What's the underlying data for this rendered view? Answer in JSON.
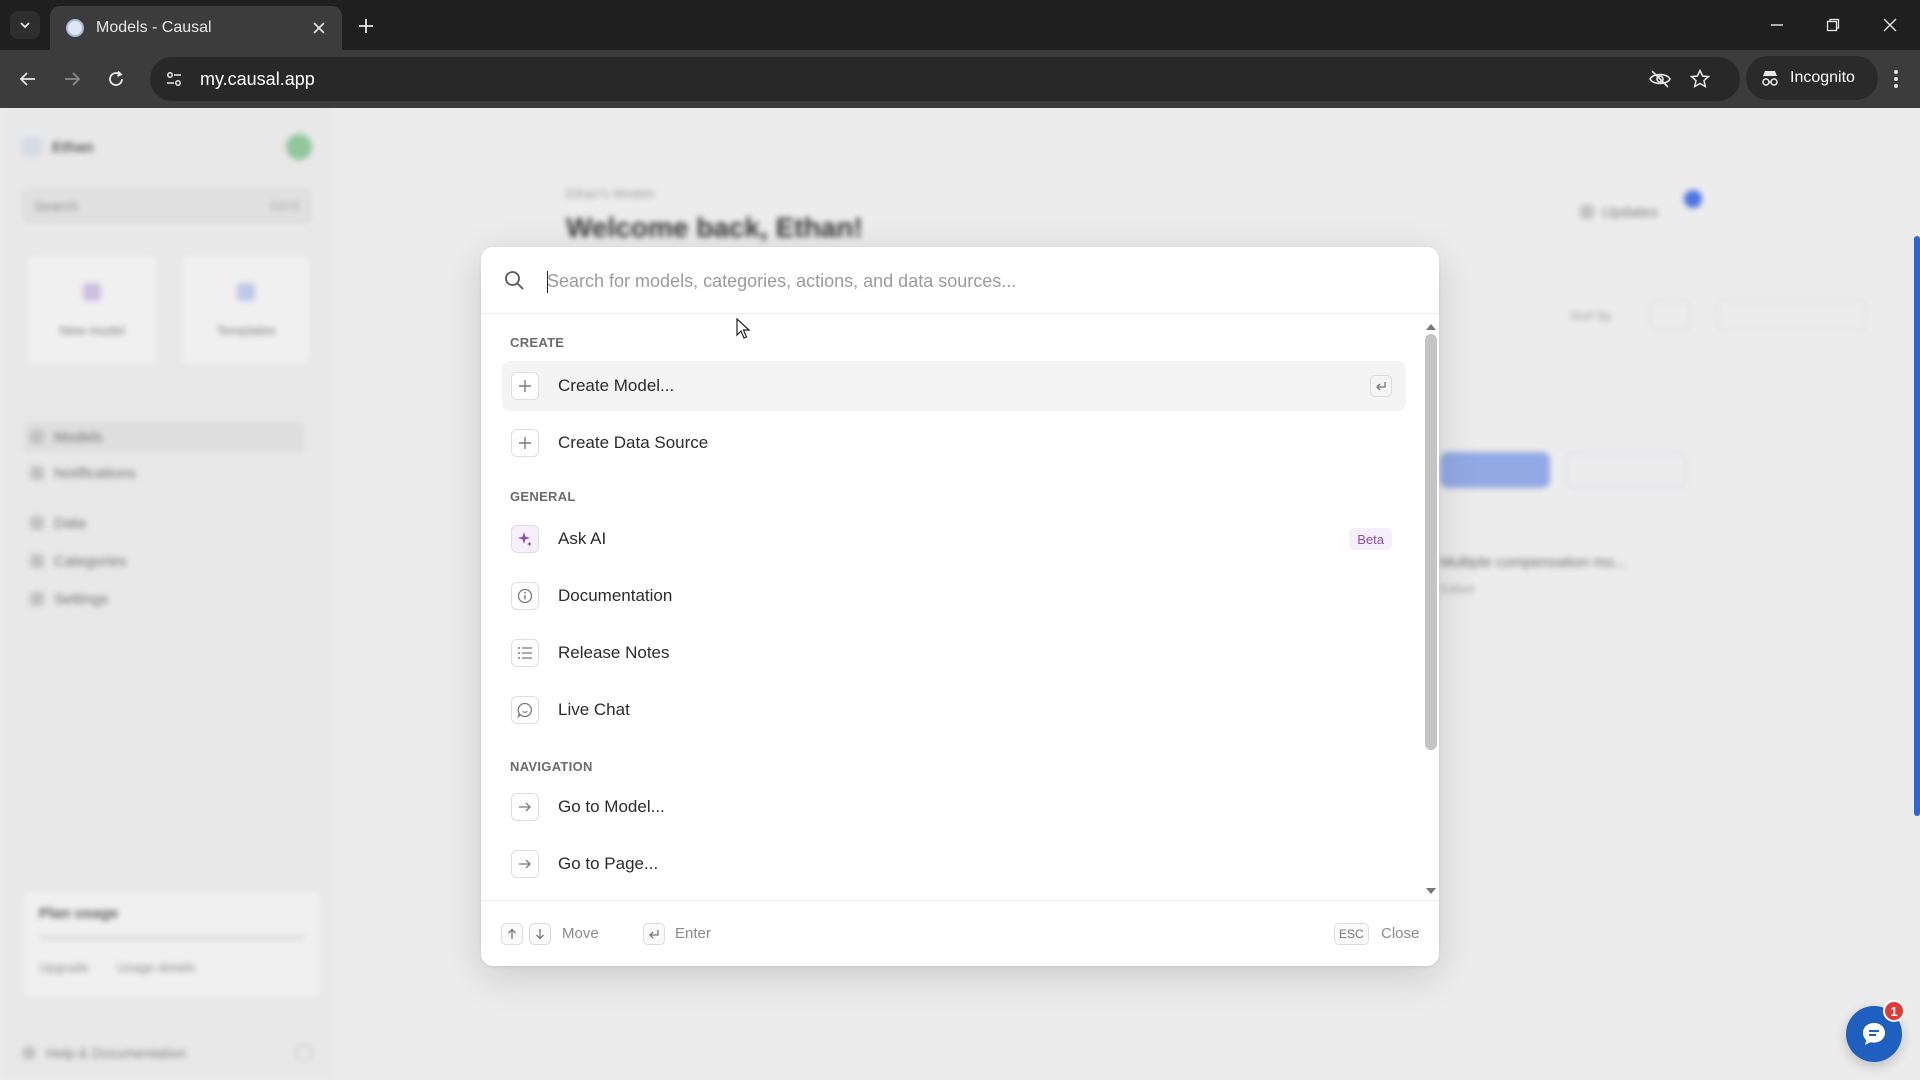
{
  "browser": {
    "tab_title": "Models - Causal",
    "url": "my.causal.app",
    "incognito_label": "Incognito"
  },
  "app": {
    "workspace_name": "Ethan",
    "search_placeholder": "Search",
    "search_kbd": "Ctrl K",
    "quick_cards": [
      "New model",
      "Templates"
    ],
    "sidebar_items": [
      "Models",
      "Notifications",
      "Data",
      "Categories",
      "Settings"
    ],
    "usage_title": "Plan usage",
    "usage_links": [
      "Upgrade",
      "Usage details"
    ],
    "footer_link": "Help & Documentation",
    "breadcrumb": "Ethan's Models",
    "welcome": "Welcome back, Ethan!",
    "updates_label": "Updates",
    "sort_label": "Sort by",
    "row_text": "Multiple compensation mo...",
    "row_sub": "Edited"
  },
  "palette": {
    "search_placeholder": "Search for models, categories, actions, and data sources...",
    "sections": {
      "create": "CREATE",
      "general": "GENERAL",
      "navigation": "NAVIGATION"
    },
    "items": {
      "create_model": "Create Model...",
      "create_data_source": "Create Data Source",
      "ask_ai": "Ask AI",
      "ask_ai_badge": "Beta",
      "documentation": "Documentation",
      "release_notes": "Release Notes",
      "live_chat": "Live Chat",
      "go_to_model": "Go to Model...",
      "go_to_page": "Go to Page..."
    },
    "footer": {
      "move": "Move",
      "enter": "Enter",
      "esc_key": "ESC",
      "close": "Close"
    }
  },
  "chat_widget": {
    "badge_count": "1"
  },
  "colors": {
    "accent_blue": "#1f5fbf",
    "ai_purple": "#8a4fb5",
    "badge_red": "#e53935"
  }
}
